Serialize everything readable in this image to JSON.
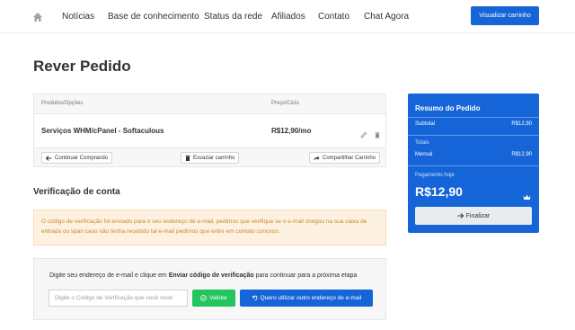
{
  "nav": {
    "home_icon": "home-icon",
    "items": [
      "Notícias",
      "Base de conhecimento",
      "Status da rede",
      "Afiliados",
      "Contato",
      "Chat Agora"
    ],
    "cart_button": "Visualizar carrinho"
  },
  "page": {
    "title": "Rever Pedido"
  },
  "cart_table": {
    "headers": {
      "product": "Produtos/Opções",
      "price": "Preço/Ciclo"
    },
    "rows": [
      {
        "product": "Serviços WHM/cPanel - Softaculous",
        "price": "R$12,90/mo"
      }
    ],
    "actions": {
      "continue": "Continuar Comprando",
      "empty": "Esvaziar carrinho",
      "share": "Compartilhar Carrinho"
    }
  },
  "summary": {
    "title": "Resumo do Pedido",
    "subtotal_label": "Subtotal",
    "subtotal_value": "R$12,90",
    "totals_label": "Totais",
    "monthly_label": "Mensal",
    "monthly_value": "R$12,90",
    "due_today_label": "Pagamento hoje",
    "due_today_value": "R$12,90",
    "finish_button": "Finalizar"
  },
  "verification": {
    "title": "Verificação de conta",
    "alert": "O código de verificação foi enviado para o seu endereço de e-mail, pedimos que verifique se o e-mail chegou na sua caixa de entrada ou span caso não tenha recebido tal e-mail pedimos que entre em contato conosco.",
    "prompt_prefix": "Digite seu endereço de e-mail e clique em ",
    "prompt_bold": "Enviar código de verificação",
    "prompt_suffix": " para continuar para a próxima etapa",
    "input_placeholder": "Digite o Código de Verificação que você recel",
    "validate_button": "Validar",
    "alt_email_button": "Quero utilizar outro endereço de e-mail"
  },
  "colors": {
    "primary": "#1565d8",
    "success": "#22c55e",
    "alert_bg": "#fdf1e1",
    "alert_text": "#c98a2d"
  }
}
